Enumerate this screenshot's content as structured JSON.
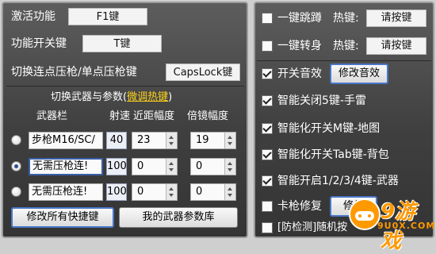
{
  "left": {
    "activate_label": "激活功能",
    "activate_key": "F1键",
    "toggle_label": "功能开关键",
    "toggle_key": "T键",
    "switch_label": "切换连点压枪/单点压枪键",
    "switch_key": "CapsLock键",
    "section_title": "切换武器与参数",
    "section_paren_open": "(",
    "section_link": "微调热键",
    "section_paren_close": ")",
    "col_weapon": "武器栏",
    "col_rate": "射速",
    "col_near": "近距幅度",
    "col_scope": "倍镜幅度",
    "rows": [
      {
        "name": "步枪M16/SC/",
        "rate": "40",
        "near": "23",
        "scope": "19",
        "selected": false
      },
      {
        "name": "无需压枪连!",
        "rate": "100",
        "near": "0",
        "scope": "0",
        "selected": true
      },
      {
        "name": "无需压枪连!",
        "rate": "100",
        "near": "0",
        "scope": "0",
        "selected": false
      }
    ],
    "btn_modify_all": "修改所有快捷键",
    "btn_weapon_db": "我的武器参数库"
  },
  "right": {
    "hotkey_label": "热键:",
    "hotkey_placeholder": "请按键",
    "items": [
      {
        "label": "一键跳蹲",
        "checked": false
      },
      {
        "label": "一键转身",
        "checked": false
      },
      {
        "label": "开关音效",
        "checked": true
      },
      {
        "label": "智能关闭5键-手雷",
        "checked": true
      },
      {
        "label": "智能化开关M键-地图",
        "checked": true
      },
      {
        "label": "智能化开关Tab键-背包",
        "checked": true
      },
      {
        "label": "智能开启1/2/3/4键-武器",
        "checked": true
      },
      {
        "label": "卡枪修复",
        "checked": false
      },
      {
        "label": "[防检测]随机按",
        "checked": false
      }
    ],
    "btn_modify_sound": "修改音效",
    "btn_partial": "修复"
  },
  "watermark": {
    "brand": "9游戏",
    "sub": "9U0X.COM"
  }
}
